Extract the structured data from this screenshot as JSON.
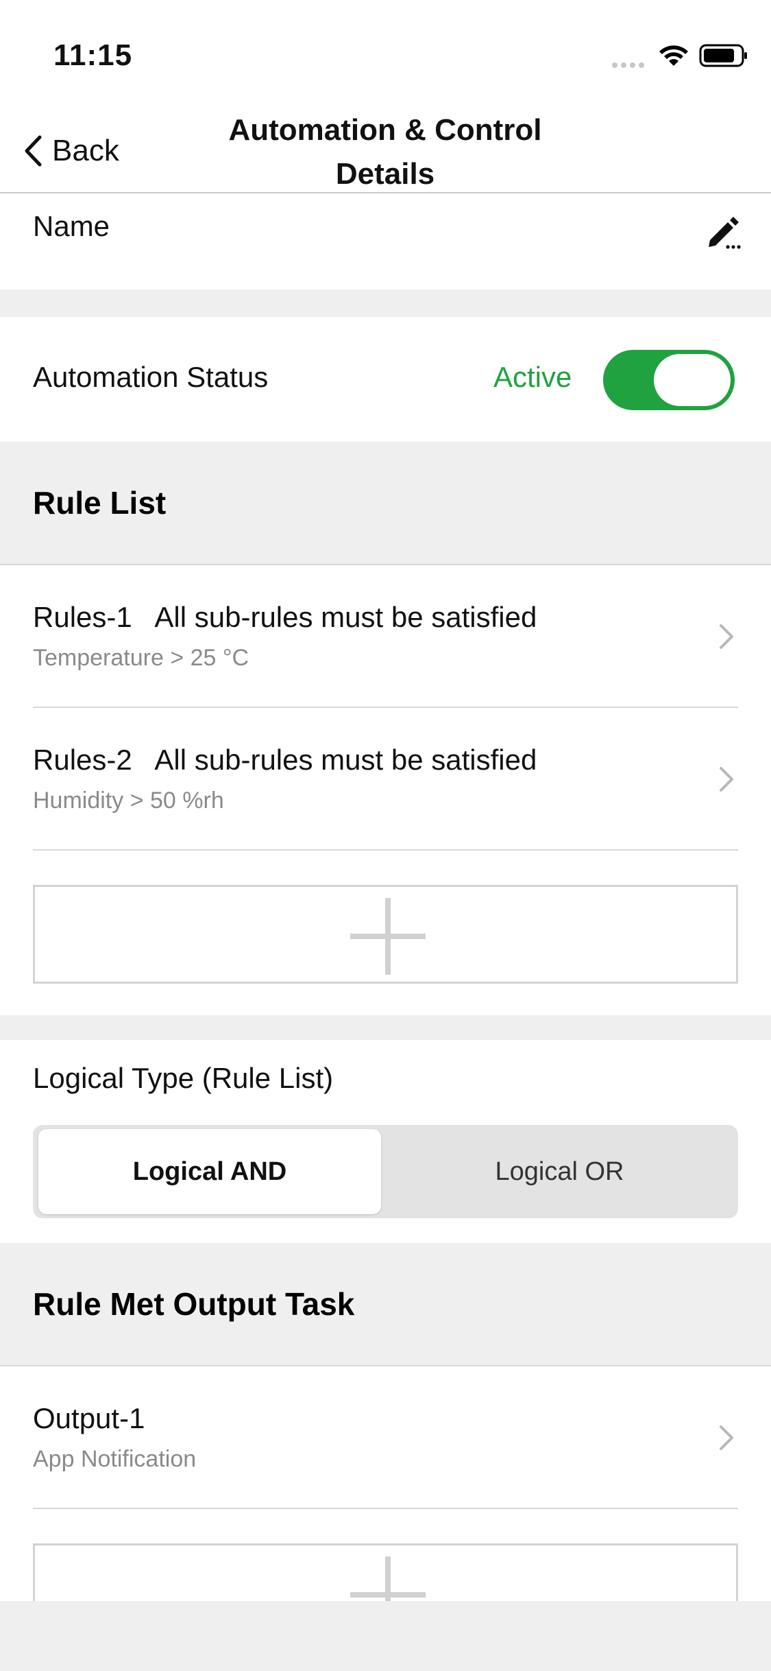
{
  "status_bar": {
    "time": "11:15"
  },
  "nav": {
    "back_label": "Back",
    "title": "Automation & Control Details"
  },
  "name_row": {
    "label": "Name"
  },
  "automation_status": {
    "label": "Automation Status",
    "value": "Active",
    "enabled": true
  },
  "rule_list": {
    "title": "Rule List",
    "items": [
      {
        "title": "Rules-1   All sub-rules must be satisfied",
        "subtitle": "Temperature > 25 °C"
      },
      {
        "title": "Rules-2   All sub-rules must be satisfied",
        "subtitle": "Humidity > 50 %rh"
      }
    ]
  },
  "logical_type": {
    "label": "Logical Type (Rule List)",
    "options": [
      "Logical AND",
      "Logical OR"
    ],
    "selected": "Logical AND"
  },
  "output_task": {
    "title": "Rule Met Output Task",
    "items": [
      {
        "title": "Output-1",
        "subtitle": "App Notification"
      }
    ]
  },
  "colors": {
    "accent_green": "#1fa23f",
    "band_gray": "#efefef"
  },
  "icons": [
    "chevron-left-icon",
    "edit-pencil-icon",
    "chevron-right-icon",
    "plus-icon",
    "wifi-icon",
    "battery-icon"
  ]
}
